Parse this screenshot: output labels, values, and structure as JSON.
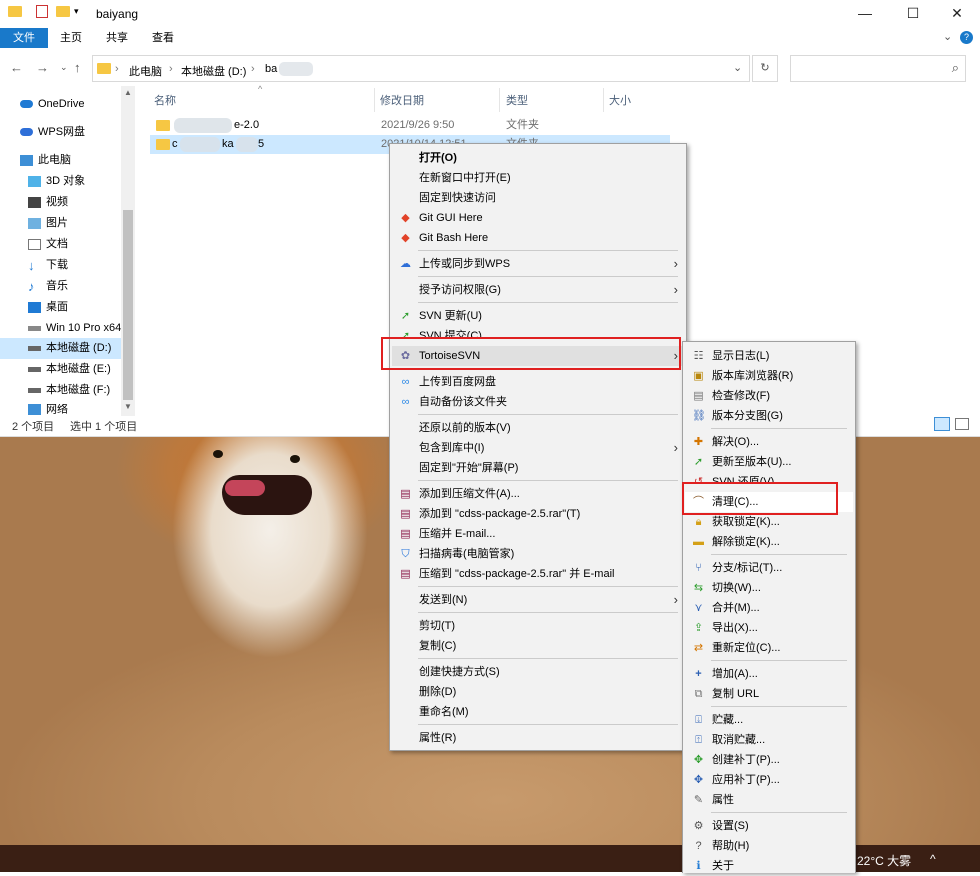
{
  "window": {
    "title": "baiyang",
    "minimize": "—",
    "maximize": "☐",
    "close": "✕",
    "help": "?",
    "ribbon_collapse": "⌄"
  },
  "ribbon": {
    "tabs": [
      "文件",
      "主页",
      "共享",
      "查看"
    ]
  },
  "address": {
    "crumbs": [
      "此电脑",
      "本地磁盘 (D:)",
      "ba"
    ],
    "separator": "›",
    "dropdown": "⌄",
    "refresh": "↻",
    "search_icon": "⌕"
  },
  "nav_buttons": {
    "back": "←",
    "forward": "→",
    "recent": "⌄",
    "up": "↑"
  },
  "sidebar": {
    "items": [
      {
        "label": "OneDrive",
        "icon": "cloud-icon"
      },
      {
        "label": "WPS网盘",
        "icon": "wps-cloud-icon"
      },
      {
        "label": "此电脑",
        "icon": "computer-icon"
      },
      {
        "label": "3D 对象",
        "icon": "cube-icon"
      },
      {
        "label": "视频",
        "icon": "video-icon"
      },
      {
        "label": "图片",
        "icon": "picture-icon"
      },
      {
        "label": "文档",
        "icon": "document-icon"
      },
      {
        "label": "下载",
        "icon": "download-icon"
      },
      {
        "label": "音乐",
        "icon": "music-icon"
      },
      {
        "label": "桌面",
        "icon": "desktop-icon"
      },
      {
        "label": "Win 10 Pro x64",
        "icon": "drive-icon"
      },
      {
        "label": "本地磁盘 (D:)",
        "icon": "drive-icon"
      },
      {
        "label": "本地磁盘 (E:)",
        "icon": "drive-icon"
      },
      {
        "label": "本地磁盘 (F:)",
        "icon": "drive-icon"
      },
      {
        "label": "网络",
        "icon": "network-icon"
      }
    ]
  },
  "file_list": {
    "columns": [
      "名称",
      "修改日期",
      "类型",
      "大小"
    ],
    "rows": [
      {
        "name_visible": "e-2.0",
        "date": "2021/9/26 9:50",
        "type": "文件夹"
      },
      {
        "name_visible_start": "c",
        "name_visible_mid": "ka",
        "name_visible_end": "5",
        "date": "2021/10/14 12:51",
        "type": "文件夹"
      }
    ]
  },
  "status": {
    "count": "2 个项目",
    "selected": "选中 1 个项目"
  },
  "context_menu": {
    "items": [
      {
        "label": "打开(O)",
        "bold": true
      },
      {
        "label": "在新窗口中打开(E)"
      },
      {
        "label": "固定到快速访问"
      },
      {
        "label": "Git GUI Here",
        "icon": "git-icon"
      },
      {
        "label": "Git Bash Here",
        "icon": "git-icon"
      },
      {
        "label": "上传或同步到WPS",
        "icon": "wps-upload-icon"
      },
      {
        "label": "授予访问权限(G)"
      },
      {
        "label": "SVN 更新(U)",
        "icon": "svn-update-icon"
      },
      {
        "label": "SVN 提交(C)...",
        "icon": "svn-commit-icon"
      },
      {
        "label": "TortoiseSVN",
        "icon": "tortoisesvn-icon"
      },
      {
        "label": "上传到百度网盘",
        "icon": "baidu-icon"
      },
      {
        "label": "自动备份该文件夹",
        "icon": "baidu-icon"
      },
      {
        "label": "还原以前的版本(V)"
      },
      {
        "label": "包含到库中(I)"
      },
      {
        "label": "固定到\"开始\"屏幕(P)"
      },
      {
        "label": "添加到压缩文件(A)...",
        "icon": "winrar-icon"
      },
      {
        "label": "添加到 \"cdss-package-2.5.rar\"(T)",
        "icon": "winrar-icon"
      },
      {
        "label": "压缩并 E-mail...",
        "icon": "winrar-icon"
      },
      {
        "label": "扫描病毒(电脑管家)",
        "icon": "shield-icon"
      },
      {
        "label": "压缩到 \"cdss-package-2.5.rar\" 并 E-mail",
        "icon": "winrar-icon"
      },
      {
        "label": "发送到(N)"
      },
      {
        "label": "剪切(T)"
      },
      {
        "label": "复制(C)"
      },
      {
        "label": "创建快捷方式(S)"
      },
      {
        "label": "删除(D)"
      },
      {
        "label": "重命名(M)"
      },
      {
        "label": "属性(R)"
      }
    ],
    "arrow": "›"
  },
  "svn_submenu": {
    "items": [
      {
        "label": "显示日志(L)",
        "icon": "log-icon"
      },
      {
        "label": "版本库浏览器(R)",
        "icon": "repo-browser-icon"
      },
      {
        "label": "检查修改(F)",
        "icon": "check-modify-icon"
      },
      {
        "label": "版本分支图(G)",
        "icon": "revision-graph-icon"
      },
      {
        "label": "解决(O)...",
        "icon": "resolve-icon"
      },
      {
        "label": "更新至版本(U)...",
        "icon": "update-icon"
      },
      {
        "label": "SVN 还原(V)...",
        "icon": "revert-icon"
      },
      {
        "label": "清理(C)...",
        "icon": "cleanup-icon"
      },
      {
        "label": "获取锁定(K)...",
        "icon": "lock-icon"
      },
      {
        "label": "解除锁定(K)...",
        "icon": "unlock-icon"
      },
      {
        "label": "分支/标记(T)...",
        "icon": "branch-icon"
      },
      {
        "label": "切换(W)...",
        "icon": "switch-icon"
      },
      {
        "label": "合并(M)...",
        "icon": "merge-icon"
      },
      {
        "label": "导出(X)...",
        "icon": "export-icon"
      },
      {
        "label": "重新定位(C)...",
        "icon": "relocate-icon"
      },
      {
        "label": "增加(A)...",
        "icon": "add-icon"
      },
      {
        "label": "复制 URL",
        "icon": "copy-url-icon"
      },
      {
        "label": "贮藏...",
        "icon": "shelve-icon"
      },
      {
        "label": "取消贮藏...",
        "icon": "unshelve-icon"
      },
      {
        "label": "创建补丁(P)...",
        "icon": "create-patch-icon"
      },
      {
        "label": "应用补丁(P)...",
        "icon": "apply-patch-icon"
      },
      {
        "label": "属性",
        "icon": "properties-icon"
      },
      {
        "label": "设置(S)",
        "icon": "settings-icon"
      },
      {
        "label": "帮助(H)",
        "icon": "help-icon"
      },
      {
        "label": "关于",
        "icon": "info-icon"
      }
    ]
  },
  "taskbar": {
    "weather": "22°C 大雾",
    "tray_chevron": "^"
  },
  "colors": {
    "accent": "#1979ca",
    "selection": "#cce8ff",
    "highlight_box": "#e02020"
  }
}
